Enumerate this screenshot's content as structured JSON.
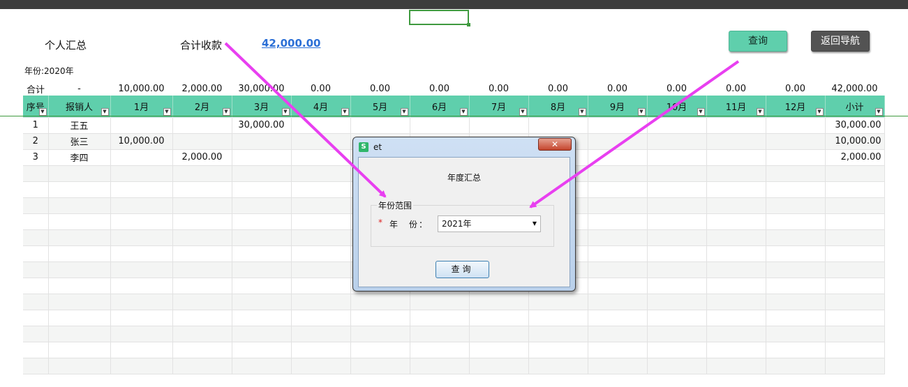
{
  "header": {
    "personal_summary": "个人汇总",
    "total_received_label": "合计收款",
    "total_received_value": "42,000.00",
    "query_button": "查询",
    "back_button": "返回导航",
    "year_label": "年份:2020年"
  },
  "table": {
    "totals": [
      "合计",
      "-",
      "10,000.00",
      "2,000.00",
      "30,000.00",
      "0.00",
      "0.00",
      "0.00",
      "0.00",
      "0.00",
      "0.00",
      "0.00",
      "0.00",
      "0.00",
      "42,000.00"
    ],
    "columns": [
      "序号",
      "报销人",
      "1月",
      "2月",
      "3月",
      "4月",
      "5月",
      "6月",
      "7月",
      "8月",
      "9月",
      "10月",
      "11月",
      "12月",
      "小计"
    ],
    "rows": [
      [
        "1",
        "王五",
        "",
        "",
        "30,000.00",
        "",
        "",
        "",
        "",
        "",
        "",
        "",
        "",
        "",
        "30,000.00"
      ],
      [
        "2",
        "张三",
        "10,000.00",
        "",
        "",
        "",
        "",
        "",
        "",
        "",
        "",
        "",
        "",
        "",
        "10,000.00"
      ],
      [
        "3",
        "李四",
        "",
        "2,000.00",
        "",
        "",
        "",
        "",
        "",
        "",
        "",
        "",
        "",
        "",
        "2,000.00"
      ]
    ]
  },
  "dialog": {
    "app_icon": "S",
    "window_title": "et",
    "close_glyph": "✕",
    "heading": "年度汇总",
    "group_label": "年份范围",
    "required_mark": "*",
    "year_field_label": "年　份：",
    "year_value": "2021年",
    "query_button": "查询"
  },
  "colors": {
    "header_green": "#5fcfac",
    "arrow_magenta": "#e83ff0",
    "link_blue": "#2b6fd6"
  }
}
